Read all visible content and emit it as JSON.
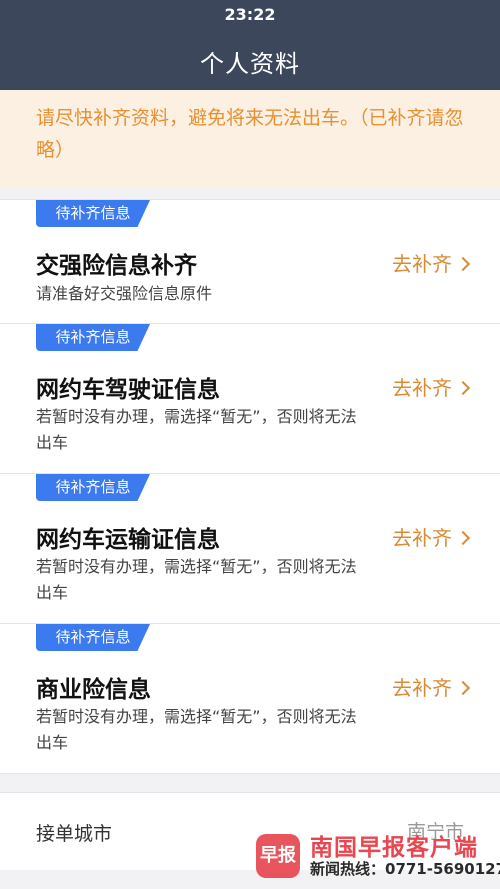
{
  "status_bar": {
    "time": "23:22"
  },
  "header": {
    "title": "个人资料"
  },
  "notice": {
    "text": "请尽快补齐资料，避免将来无法出车。（已补齐请忽略）"
  },
  "cards": [
    {
      "tag": "待补齐信息",
      "title": "交强险信息补齐",
      "desc": "请准备好交强险信息原件",
      "action": "去补齐"
    },
    {
      "tag": "待补齐信息",
      "title": "网约车驾驶证信息",
      "desc": "若暂时没有办理，需选择“暂无”，否则将无法出车",
      "action": "去补齐"
    },
    {
      "tag": "待补齐信息",
      "title": "网约车运输证信息",
      "desc": "若暂时没有办理，需选择“暂无”，否则将无法出车",
      "action": "去补齐"
    },
    {
      "tag": "待补齐信息",
      "title": "商业险信息",
      "desc": "若暂时没有办理，需选择“暂无”，否则将无法出车",
      "action": "去补齐"
    }
  ],
  "city": {
    "label": "接单城市",
    "value": "南宁市"
  },
  "watermark": {
    "logo": "早报",
    "name": "南国早报客户端",
    "hotline": "新闻热线：0771-5690127"
  },
  "colors": {
    "header_bg": "#3d475b",
    "notice_text": "#e59134",
    "tag_bg": "#3c7af0",
    "action": "#d98b35",
    "watermark": "#e8474f"
  }
}
